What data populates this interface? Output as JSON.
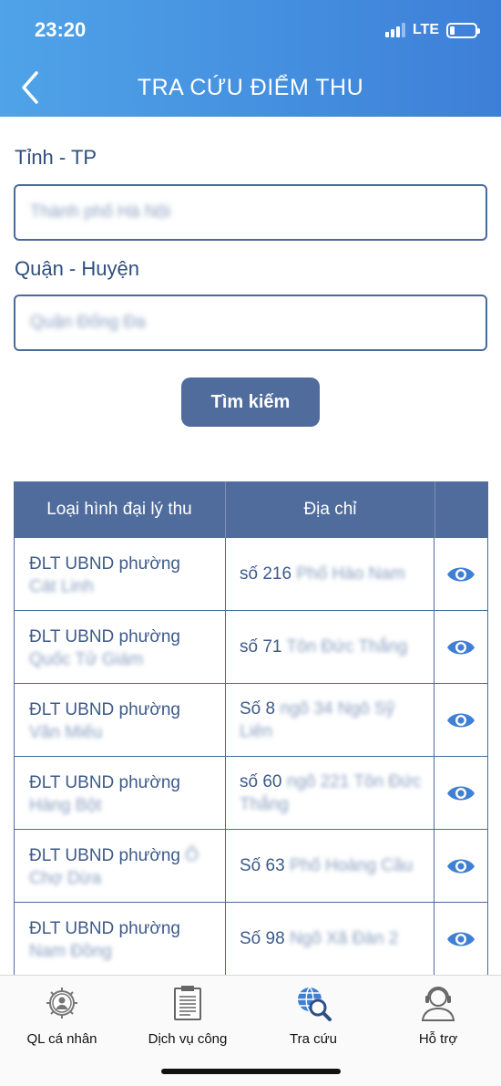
{
  "status": {
    "time": "23:20",
    "network": "LTE"
  },
  "header": {
    "title": "TRA CỨU ĐIỂM THU"
  },
  "form": {
    "province_label": "Tỉnh - TP",
    "province_value": "Thành phố Hà Nội",
    "district_label": "Quận - Huyện",
    "district_value": "Quận Đống Đa",
    "search_label": "Tìm kiếm"
  },
  "table": {
    "headers": [
      "Loại hình đại lý thu",
      "Địa chỉ"
    ],
    "rows": [
      {
        "type_visible": "ĐLT UBND phường",
        "type_blur": "Cát Linh",
        "addr_visible": "số 216",
        "addr_blur": "Phố Hào Nam"
      },
      {
        "type_visible": "ĐLT UBND phường",
        "type_blur": "Quốc Tử Giám",
        "addr_visible": "số 71",
        "addr_blur": "Tôn Đức Thắng"
      },
      {
        "type_visible": "ĐLT UBND phường",
        "type_blur": "Văn Miếu",
        "addr_visible": "Số 8",
        "addr_blur": "ngõ 34 Ngô Sỹ Liên"
      },
      {
        "type_visible": "ĐLT UBND phường",
        "type_blur": "Hàng Bột",
        "addr_visible": "số 60",
        "addr_blur": "ngõ 221 Tôn Đức Thắng"
      },
      {
        "type_visible": "ĐLT UBND phường",
        "type_blur": "Ô Chợ Dừa",
        "addr_visible": "Số 63",
        "addr_blur": "Phố Hoàng Cầu"
      },
      {
        "type_visible": "ĐLT UBND phường",
        "type_blur": "Nam Đồng",
        "addr_visible": "Số 98",
        "addr_blur": "Ngõ Xã Đàn 2"
      }
    ]
  },
  "tabs": [
    {
      "label": "QL cá nhân",
      "icon": "gear-person-icon"
    },
    {
      "label": "Dịch vụ công",
      "icon": "document-icon"
    },
    {
      "label": "Tra cứu",
      "icon": "globe-search-icon"
    },
    {
      "label": "Hỗ trợ",
      "icon": "support-person-icon"
    }
  ],
  "colors": {
    "header_start": "#4fa3e8",
    "header_end": "#3d7fd8",
    "primary": "#4f6c9c",
    "eye": "#3f7fd6"
  }
}
